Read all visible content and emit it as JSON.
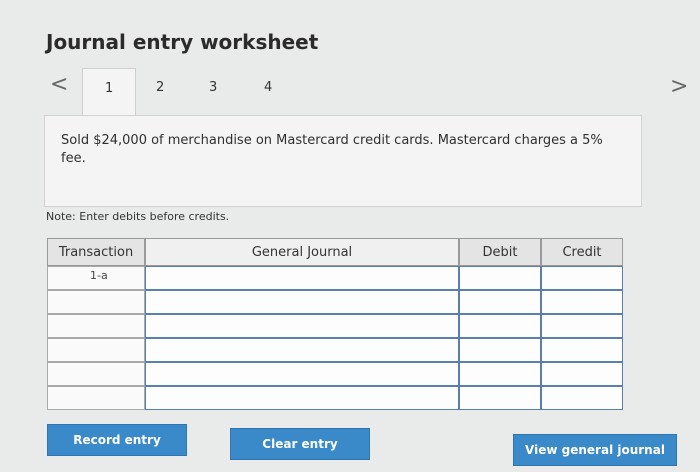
{
  "header": {
    "title": "Journal entry worksheet"
  },
  "tabs": [
    "1",
    "2",
    "3",
    "4"
  ],
  "nav": {
    "prev_glyph": "<",
    "next_glyph": ">"
  },
  "question": {
    "text": "Sold $24,000 of merchandise on Mastercard credit cards. Mastercard charges a 5% fee."
  },
  "note": "Note: Enter debits before credits.",
  "table": {
    "headers": {
      "transaction": "Transaction",
      "general_journal": "General Journal",
      "debit": "Debit",
      "credit": "Credit"
    },
    "rows": [
      {
        "transaction": "1-a",
        "account": "",
        "debit": "",
        "credit": ""
      },
      {
        "transaction": "",
        "account": "",
        "debit": "",
        "credit": ""
      },
      {
        "transaction": "",
        "account": "",
        "debit": "",
        "credit": ""
      },
      {
        "transaction": "",
        "account": "",
        "debit": "",
        "credit": ""
      },
      {
        "transaction": "",
        "account": "",
        "debit": "",
        "credit": ""
      },
      {
        "transaction": "",
        "account": "",
        "debit": "",
        "credit": ""
      }
    ]
  },
  "buttons": {
    "record": "Record entry",
    "clear": "Clear entry",
    "view": "View general journal"
  },
  "colors": {
    "button_blue": "#3a89c9",
    "input_border": "#5a7fa8"
  }
}
